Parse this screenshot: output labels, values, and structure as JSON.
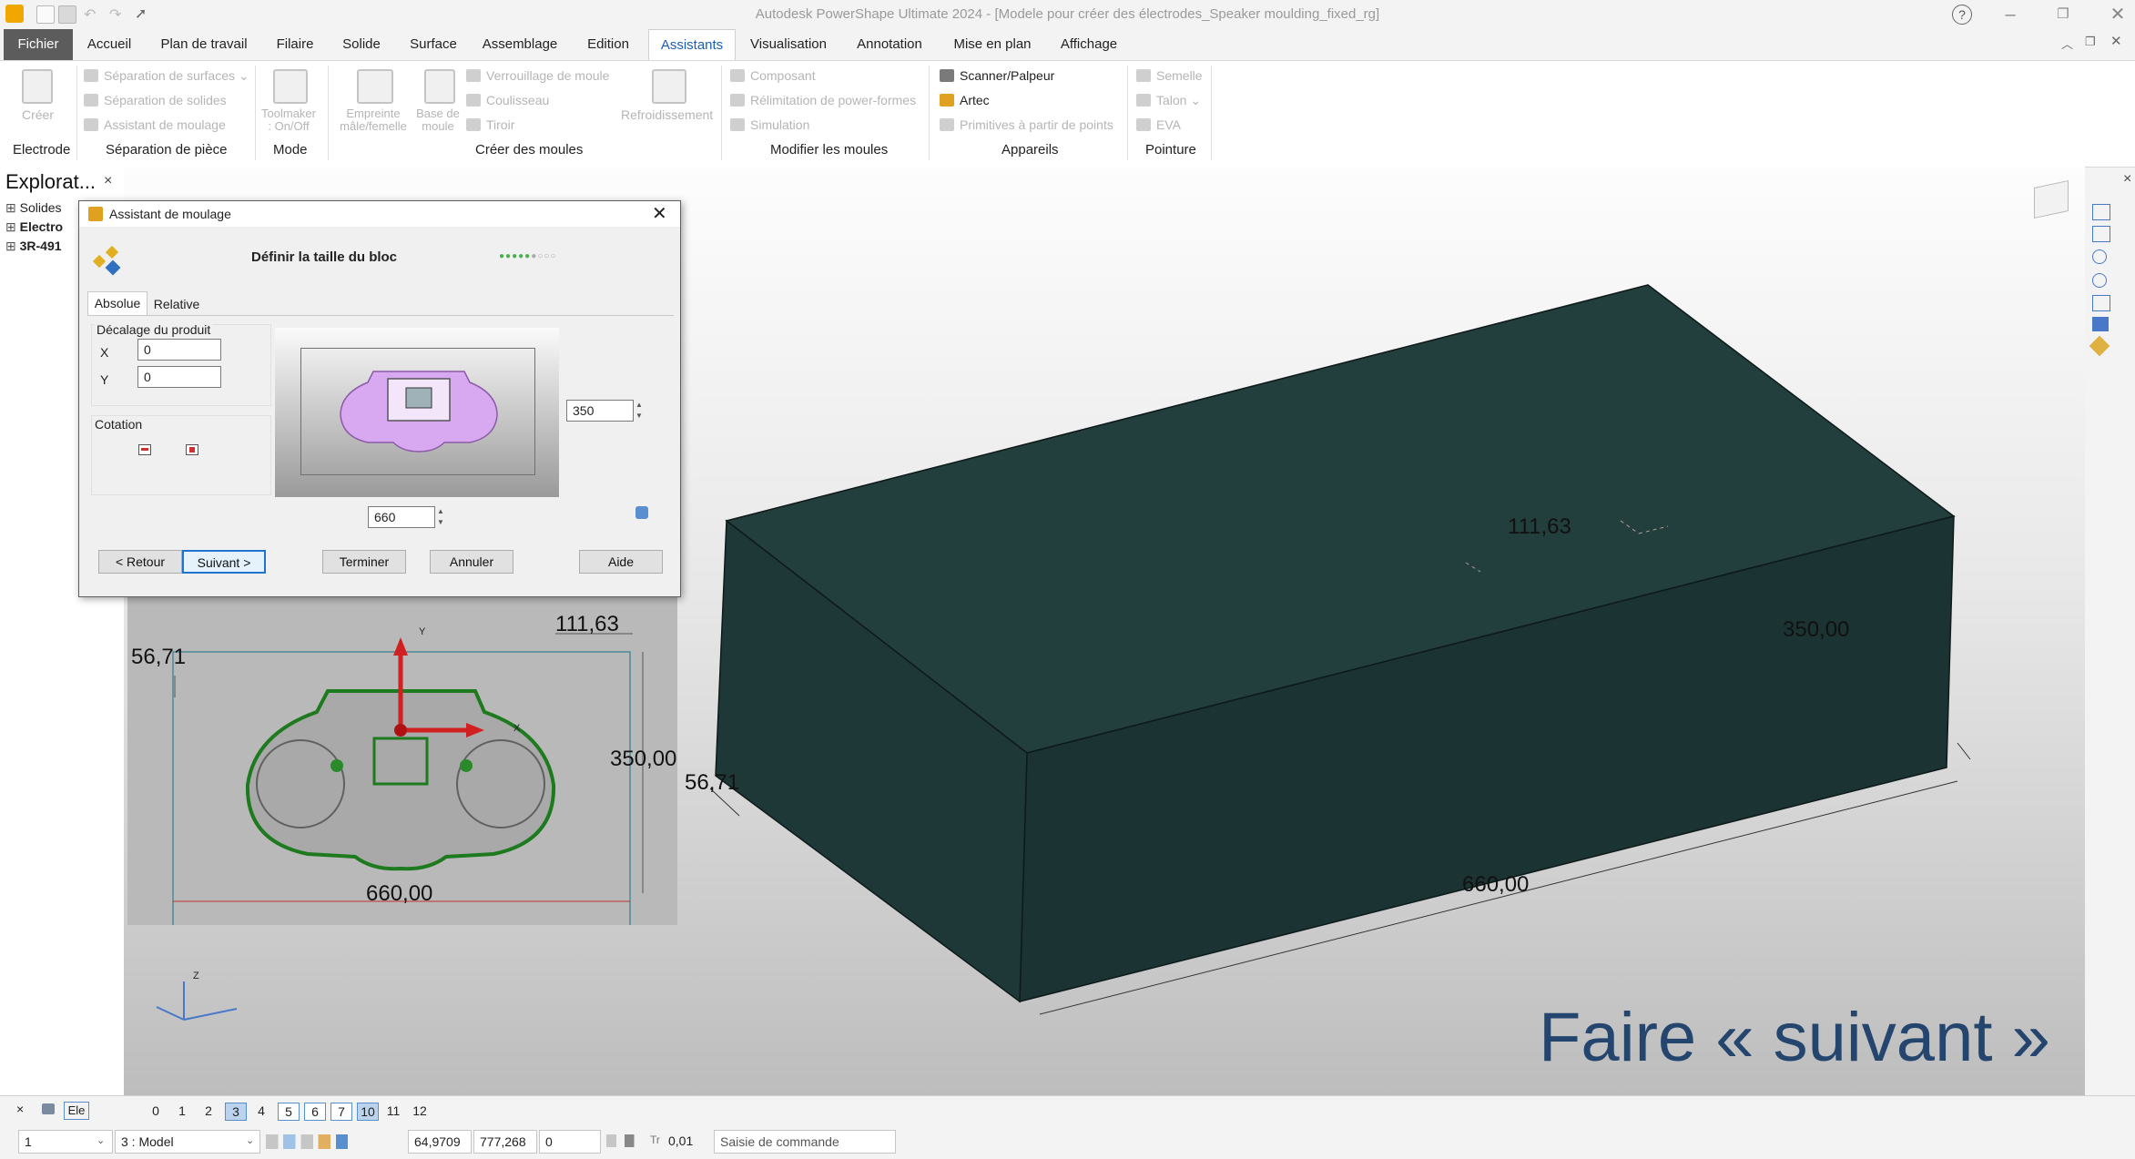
{
  "titlebar": {
    "title": "Autodesk PowerShape Ultimate 2024 - [Modele pour créer des électrodes_Speaker moulding_fixed_rg]",
    "help": "?"
  },
  "tabs": [
    "Fichier",
    "Accueil",
    "Plan de travail",
    "Filaire",
    "Solide",
    "Surface",
    "Assemblage",
    "Edition",
    "Assistants",
    "Visualisation",
    "Annotation",
    "Mise en plan",
    "Affichage"
  ],
  "active_tab": "Assistants",
  "ribbon": {
    "electrode": {
      "create": "Créer",
      "label": "Electrode"
    },
    "separation": {
      "items": [
        "Séparation de surfaces",
        "Séparation de solides",
        "Assistant de moulage"
      ],
      "label": "Séparation de pièce"
    },
    "mode": {
      "toolmaker": "Toolmaker : On/Off",
      "label": "Mode"
    },
    "moules": {
      "empreinte": "Empreinte mâle/femelle",
      "base": "Base de moule",
      "items": [
        "Verrouillage de moule",
        "Coulisseau",
        "Tiroir"
      ],
      "refroid": "Refroidissement",
      "label": "Créer des moules"
    },
    "modifier": {
      "items": [
        "Composant",
        "Rélimitation de power-formes",
        "Simulation"
      ],
      "label": "Modifier les moules"
    },
    "appareils": {
      "items": [
        "Scanner/Palpeur",
        "Artec",
        "Primitives à partir de points"
      ],
      "label": "Appareils"
    },
    "pointure": {
      "items": [
        "Semelle",
        "Talon",
        "EVA"
      ],
      "label": "Pointure"
    }
  },
  "explorer": {
    "title": "Explorat...",
    "items": [
      "Solides",
      "Electro",
      "3R-491"
    ]
  },
  "dialog": {
    "title": "Assistant de moulage",
    "heading": "Définir la taille du bloc",
    "tabs": [
      "Absolue",
      "Relative"
    ],
    "offset_group": "Décalage du produit",
    "x_label": "X",
    "x_value": "0",
    "y_label": "Y",
    "y_value": "0",
    "cotation": "Cotation",
    "height_value": "350",
    "width_value": "660",
    "buttons": {
      "back": "< Retour",
      "next": "Suivant >",
      "finish": "Terminer",
      "cancel": "Annuler",
      "help": "Aide"
    }
  },
  "preview_2d": {
    "top": "111,63",
    "left": "56,71",
    "right": "350,00",
    "bottom": "660,00"
  },
  "block_3d": {
    "top": "111,63",
    "right": "350,00",
    "left": "56,71",
    "bottom": "660,00",
    "color": "#1f3a39"
  },
  "axis_labels": {
    "y": "Y",
    "x": "X",
    "z": "Z"
  },
  "overlay_text": "Faire « suivant »",
  "statusbar": {
    "close": "×",
    "filter": "Ele",
    "levels": [
      "0",
      "1",
      "2",
      "3",
      "4",
      "5",
      "6",
      "7",
      "10",
      "11",
      "12"
    ],
    "level_field": "1",
    "workplane": "3   : Model",
    "coord_x": "64,9709",
    "coord_y": "777,268",
    "coord_z": "0",
    "tol_label": "Tr",
    "tolerance": "0,01",
    "command_placeholder": "Saisie de commande"
  }
}
